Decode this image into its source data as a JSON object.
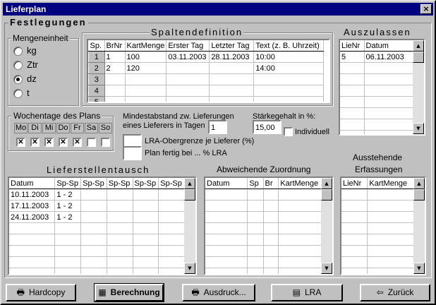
{
  "window": {
    "title": "Lieferplan",
    "close_label": "×"
  },
  "festlegungen": {
    "title": "Festlegungen"
  },
  "mengeneinheit": {
    "title": "Mengeneinheit",
    "options": [
      {
        "label": "kg",
        "selected": false
      },
      {
        "label": "Ztr",
        "selected": false
      },
      {
        "label": "dz",
        "selected": true
      },
      {
        "label": "t",
        "selected": false
      }
    ]
  },
  "spaltendefinition": {
    "title": "Spaltendefinition",
    "columns": [
      "Sp.",
      "BrNr",
      "KartMenge",
      "Erster Tag",
      "Letzter Tag",
      "Text (z. B. Uhrzeit)"
    ],
    "rows": [
      [
        "1",
        "1",
        "100",
        "03.11.2003",
        "28.11.2003",
        "10:00"
      ],
      [
        "2",
        "2",
        "120",
        "",
        "",
        "14:00"
      ],
      [
        "3",
        "",
        "",
        "",
        "",
        ""
      ],
      [
        "4",
        "",
        "",
        "",
        "",
        ""
      ],
      [
        "5",
        "",
        "",
        "",
        "",
        ""
      ]
    ]
  },
  "auszulassen": {
    "title": "Auszulassen",
    "columns": [
      "LieNr",
      "Datum"
    ],
    "rows": [
      [
        "5",
        "06.11.2003"
      ]
    ]
  },
  "wochentage": {
    "title": "Wochentage des Plans",
    "days": [
      "Mo",
      "Di",
      "Mi",
      "Do",
      "Fr",
      "Sa",
      "So"
    ],
    "checked": [
      true,
      true,
      true,
      true,
      true,
      false,
      false
    ],
    "check_mark": "✕"
  },
  "settings": {
    "mindestabstand_label_1": "Mindestabstand zw. Lieferungen",
    "mindestabstand_label_2": "eines Lieferers in Tagen",
    "mindestabstand_value": "1",
    "staerke_label": "Stärkegehalt in %:",
    "staerke_value": "15,00",
    "individuell_label": "Individuell",
    "lra_obergrenze_label": "LRA-Obergrenze je Lieferer (%)",
    "lra_obergrenze_value": "",
    "plan_fertig_label": "Plan fertig bei ... % LRA",
    "plan_fertig_value": ""
  },
  "lieferstellentausch": {
    "title": "Lieferstellentausch",
    "columns": [
      "Datum",
      "Sp-Sp",
      "Sp-Sp",
      "Sp-Sp",
      "Sp-Sp",
      "Sp-Sp"
    ],
    "rows": [
      [
        "10.11.2003",
        "1 - 2",
        "",
        "",
        "",
        ""
      ],
      [
        "17.11.2003",
        "1 - 2",
        "",
        "",
        "",
        ""
      ],
      [
        "24.11.2003",
        "1 - 2",
        "",
        "",
        "",
        ""
      ]
    ]
  },
  "abweichende": {
    "title": "Abweichende Zuordnung",
    "columns": [
      "Datum",
      "Sp",
      "Br",
      "KartMenge"
    ]
  },
  "ausstehende": {
    "title_1": "Ausstehende",
    "title_2": "Erfassungen",
    "columns": [
      "LieNr",
      "KartMenge"
    ]
  },
  "buttons": {
    "hardcopy": "Hardcopy",
    "berechnung": "Berechnung",
    "ausdruck": "Ausdruck...",
    "lra": "LRA",
    "zurueck": "Zurück"
  },
  "icons": {
    "printer": "🖶",
    "calculator": "▦",
    "table": "▤",
    "exit": "⇦"
  }
}
